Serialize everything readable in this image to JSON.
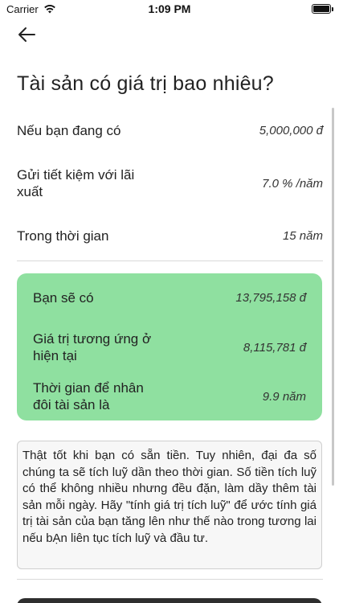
{
  "status_bar": {
    "carrier": "Carrier",
    "time": "1:09 PM"
  },
  "header": {
    "title": "Tài sản có giá trị bao nhiêu?"
  },
  "inputs": [
    {
      "label": "Nếu bạn đang có",
      "value": "5,000,000 đ"
    },
    {
      "label": "Gửi tiết kiệm với lãi xuất",
      "value": "7.0 % /năm"
    },
    {
      "label": "Trong thời gian",
      "value": "15 năm"
    }
  ],
  "results": {
    "background": "#8fe0a0",
    "rows": [
      {
        "label": "Bạn sẽ có",
        "value": "13,795,158 đ"
      },
      {
        "label": "Giá trị tương ứng ở hiện tại",
        "value": "8,115,781 đ"
      },
      {
        "label": "Thời gian để nhân đôi tài sản là",
        "value": "9.9 năm"
      }
    ]
  },
  "info": {
    "text": "Thật tốt khi bạn có sẵn tiền. Tuy nhiên, đại đa số chúng ta sẽ tích luỹ dần theo thời gian. Số tiền tích luỹ có thể không nhiều nhưng đều đặn, làm dầy thêm tài sản mỗi ngày. Hãy \"tính giá trị tích luỹ\" để ước tính giá trị tài sản của bạn tăng lên như thế nào trong tương lai nếu bẠn liên tục tích luỹ và đầu tư."
  },
  "icons": {
    "back": "arrow-left-icon",
    "wifi": "wifi-icon",
    "battery": "battery-icon"
  }
}
